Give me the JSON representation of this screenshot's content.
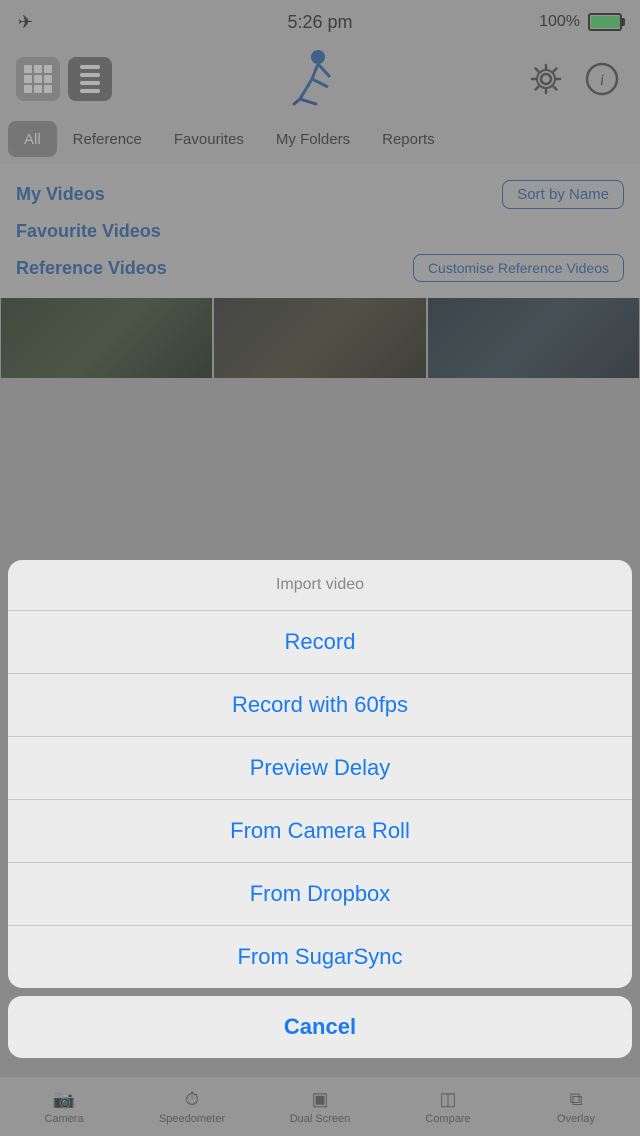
{
  "statusBar": {
    "time": "5:26 pm",
    "battery": "100%"
  },
  "toolbar": {
    "gridIcon": "⊞",
    "listIcon": "≡",
    "skierEmoji": "⛷",
    "gearLabel": "Settings",
    "infoLabel": "Info"
  },
  "tabs": [
    {
      "id": "all",
      "label": "All",
      "active": true
    },
    {
      "id": "reference",
      "label": "Reference",
      "active": false
    },
    {
      "id": "favourites",
      "label": "Favourites",
      "active": false
    },
    {
      "id": "myfolders",
      "label": "My Folders",
      "active": false
    },
    {
      "id": "reports",
      "label": "Reports",
      "active": false
    }
  ],
  "content": {
    "myVideos": "My Videos",
    "sortByName": "Sort by Name",
    "favouriteVideos": "Favourite Videos",
    "referenceVideos": "Reference Videos",
    "customiseBtn": "Customise Reference Videos"
  },
  "actionSheet": {
    "title": "Import video",
    "items": [
      {
        "id": "record",
        "label": "Record"
      },
      {
        "id": "record60fps",
        "label": "Record with 60fps"
      },
      {
        "id": "previewDelay",
        "label": "Preview Delay"
      },
      {
        "id": "cameraRoll",
        "label": "From Camera Roll"
      },
      {
        "id": "dropbox",
        "label": "From Dropbox"
      },
      {
        "id": "sugarSync",
        "label": "From SugarSync"
      }
    ],
    "cancel": "Cancel"
  },
  "bottomBar": {
    "tabs": [
      {
        "id": "camera",
        "label": "Camera",
        "icon": "📷"
      },
      {
        "id": "speedometer",
        "label": "Speedometer",
        "icon": "⏱"
      },
      {
        "id": "dualScreen",
        "label": "Dual Screen",
        "icon": "▣"
      },
      {
        "id": "compare",
        "label": "Compare",
        "icon": "◫"
      },
      {
        "id": "overlay",
        "label": "Overlay",
        "icon": "⧉"
      }
    ]
  }
}
